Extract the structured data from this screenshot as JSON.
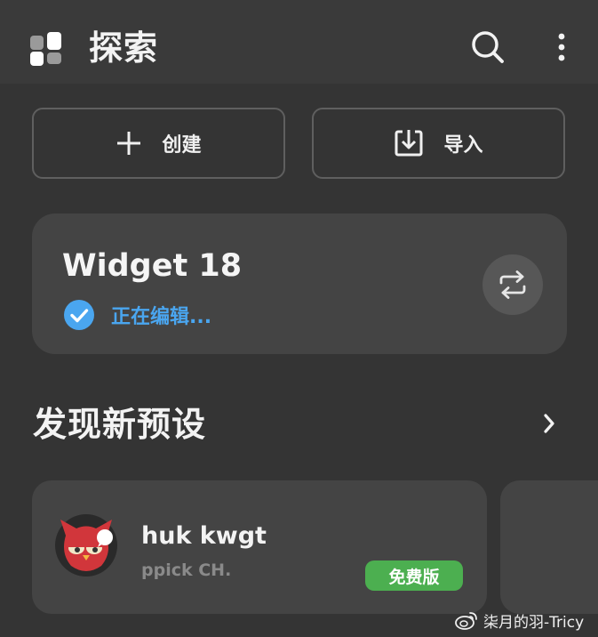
{
  "header": {
    "title": "探索",
    "logo_icon": "grid-apps-icon",
    "search_icon": "search-icon",
    "more_icon": "more-vertical-icon"
  },
  "actions": {
    "create_label": "创建",
    "create_icon": "plus-icon",
    "import_label": "导入",
    "import_icon": "download-icon"
  },
  "widget": {
    "title": "Widget 18",
    "status": "正在编辑...",
    "status_icon": "check-circle-icon",
    "switch_icon": "swap-icon"
  },
  "discover": {
    "title": "发现新预设",
    "arrow_icon": "chevron-right-icon"
  },
  "presets": [
    {
      "name": "huk kwgt",
      "author": "ppick CH.",
      "badge": "免费版",
      "avatar_icon": "red-bird-avatar"
    }
  ],
  "watermark": {
    "text": "柒月的羽-Tricy",
    "icon": "weibo-icon"
  },
  "colors": {
    "background": "#343434",
    "topbar": "#3a3a3a",
    "card": "#444444",
    "accent_blue": "#4aa6f0",
    "badge_green": "#4caf50"
  }
}
